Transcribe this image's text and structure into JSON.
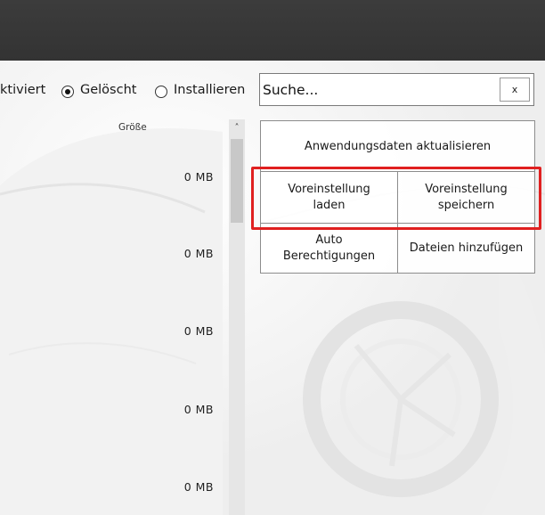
{
  "filters": {
    "activated_label": "ktiviert",
    "deleted_label": "Gelöscht",
    "install_label": "Installieren",
    "selected": "deleted"
  },
  "search": {
    "value": "Suche...",
    "clear_label": "x"
  },
  "list": {
    "size_header": "Größe",
    "sizes": [
      "0  MB",
      "0  MB",
      "0  MB",
      "0  MB",
      "0  MB"
    ]
  },
  "actions": {
    "refresh_label": "Anwendungsdaten aktualisieren",
    "load_preset_label": "Voreinstellung laden",
    "save_preset_label": "Voreinstellung speichern",
    "auto_permissions_label": "Auto Berechtigungen",
    "add_files_label": "Dateien hinzufügen"
  },
  "colors": {
    "titlebar": "#383838",
    "highlight": "#e02020"
  }
}
